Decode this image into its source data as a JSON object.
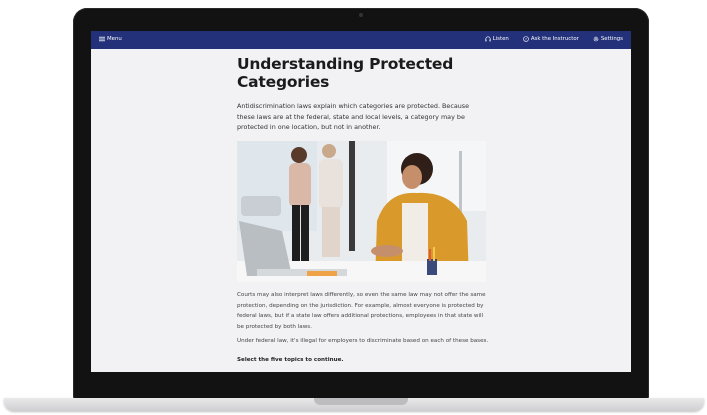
{
  "topbar": {
    "menu_label": "Menu",
    "listen_label": "Listen",
    "ask_label": "Ask the Instructor",
    "settings_label": "Settings",
    "bg_color": "#22317a"
  },
  "page": {
    "title": "Understanding Protected Categories",
    "intro": "Antidiscrimination laws explain which categories are protected. Because these laws are at the federal, state and local levels, a category may be protected in one location, but not in another.",
    "paragraph1": "Courts may also interpret laws differently, so even the same law may not offer the same protection, depending on the jurisdiction. For example, almost everyone is protected by federal laws, but if a state law offers additional protections, employees in that state will be protected by both laws.",
    "paragraph2": "Under federal law, it's illegal for employers to discriminate based on each of these bases.",
    "instruction": "Select the five topics to continue."
  },
  "icons": {
    "menu": "hamburger-icon",
    "listen": "headphones-icon",
    "ask": "question-circle-icon",
    "settings": "gear-icon"
  }
}
